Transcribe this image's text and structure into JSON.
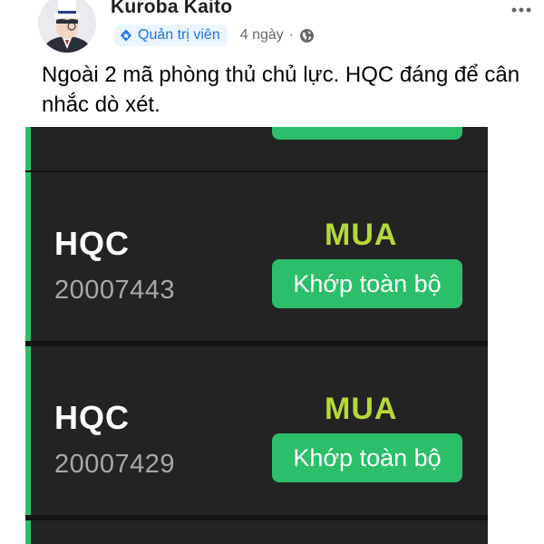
{
  "post": {
    "author": "Kuroba Kaito",
    "role": "Quản trị viên",
    "time": "4 ngày",
    "separator": "·",
    "text": "Ngoài 2 mã phòng thủ chủ lực. HQC đáng để cân nhắc dò xét."
  },
  "orders": [
    {
      "ticker": "HQC",
      "order_id": "20007443",
      "side": "MUA",
      "status": "Khớp toàn bộ"
    },
    {
      "ticker": "HQC",
      "order_id": "20007429",
      "side": "MUA",
      "status": "Khớp toàn bộ"
    }
  ],
  "colors": {
    "role_badge": "#1b74e4",
    "status_green": "#2bbf6a",
    "buy_label": "#b6d93a",
    "card_bg": "#232323"
  },
  "icons": [
    "avatar",
    "shield-star-icon",
    "globe-icon",
    "more-icon"
  ]
}
